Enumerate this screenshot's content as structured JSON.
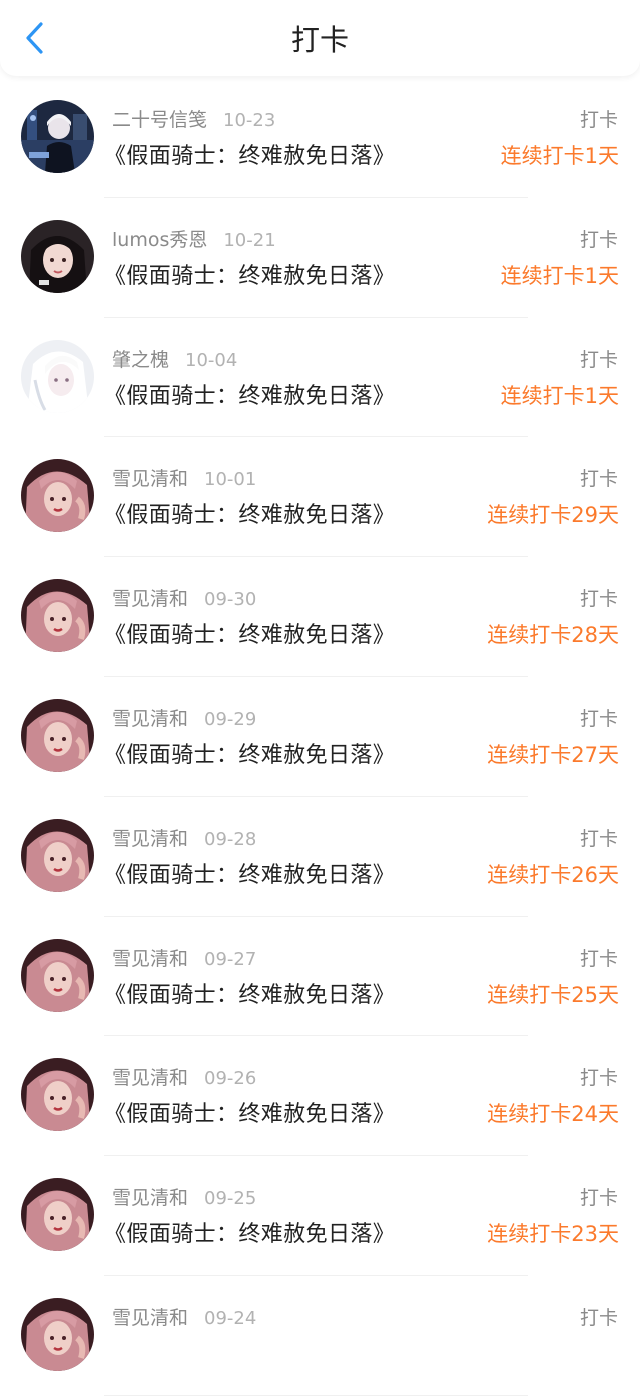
{
  "header": {
    "title": "打卡",
    "back_icon": "chevron-left-icon",
    "accent_color": "#2d95f4"
  },
  "colors": {
    "streak": "#fb7a2c",
    "meta": "#8a8a8a",
    "date": "#b2b2b2",
    "text": "#222222"
  },
  "entries": [
    {
      "username": "二十号信笺",
      "date": "10-23",
      "book": "《假面骑士：终难赦免日落》",
      "tag": "打卡",
      "streak": "连续打卡1天",
      "avatar": "avatar-dark-scene"
    },
    {
      "username": "lumos秀恩",
      "date": "10-21",
      "book": "《假面骑士：终难赦免日落》",
      "tag": "打卡",
      "streak": "连续打卡1天",
      "avatar": "avatar-black-hair"
    },
    {
      "username": "肇之槐",
      "date": "10-04",
      "book": "《假面骑士：终难赦免日落》",
      "tag": "打卡",
      "streak": "连续打卡1天",
      "avatar": "avatar-white-hair"
    },
    {
      "username": "雪见清和",
      "date": "10-01",
      "book": "《假面骑士：终难赦免日落》",
      "tag": "打卡",
      "streak": "连续打卡29天",
      "avatar": "avatar-pink-hair"
    },
    {
      "username": "雪见清和",
      "date": "09-30",
      "book": "《假面骑士：终难赦免日落》",
      "tag": "打卡",
      "streak": "连续打卡28天",
      "avatar": "avatar-pink-hair"
    },
    {
      "username": "雪见清和",
      "date": "09-29",
      "book": "《假面骑士：终难赦免日落》",
      "tag": "打卡",
      "streak": "连续打卡27天",
      "avatar": "avatar-pink-hair"
    },
    {
      "username": "雪见清和",
      "date": "09-28",
      "book": "《假面骑士：终难赦免日落》",
      "tag": "打卡",
      "streak": "连续打卡26天",
      "avatar": "avatar-pink-hair"
    },
    {
      "username": "雪见清和",
      "date": "09-27",
      "book": "《假面骑士：终难赦免日落》",
      "tag": "打卡",
      "streak": "连续打卡25天",
      "avatar": "avatar-pink-hair"
    },
    {
      "username": "雪见清和",
      "date": "09-26",
      "book": "《假面骑士：终难赦免日落》",
      "tag": "打卡",
      "streak": "连续打卡24天",
      "avatar": "avatar-pink-hair"
    },
    {
      "username": "雪见清和",
      "date": "09-25",
      "book": "《假面骑士：终难赦免日落》",
      "tag": "打卡",
      "streak": "连续打卡23天",
      "avatar": "avatar-pink-hair"
    },
    {
      "username": "雪见清和",
      "date": "09-24",
      "book": "",
      "tag": "打卡",
      "streak": "",
      "avatar": "avatar-pink-hair"
    }
  ]
}
